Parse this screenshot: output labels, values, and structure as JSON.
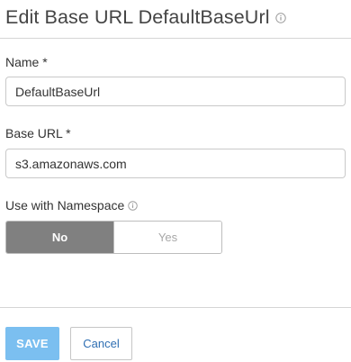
{
  "header": {
    "title": "Edit Base URL DefaultBaseUrl",
    "info_icon": "info-circle-icon"
  },
  "form": {
    "name": {
      "label": "Name *",
      "value": "DefaultBaseUrl"
    },
    "base_url": {
      "label": "Base URL *",
      "value": "s3.amazonaws.com"
    },
    "namespace": {
      "label": "Use with Namespace",
      "info_icon": "info-circle-icon",
      "options": [
        "No",
        "Yes"
      ],
      "selected": "No"
    }
  },
  "actions": {
    "save_label": "SAVE",
    "cancel_label": "Cancel"
  },
  "colors": {
    "save_button": "#7bbff0",
    "toggle_active": "#808080",
    "cancel_text": "#2f6fb3",
    "divider": "#d5d5d5"
  }
}
